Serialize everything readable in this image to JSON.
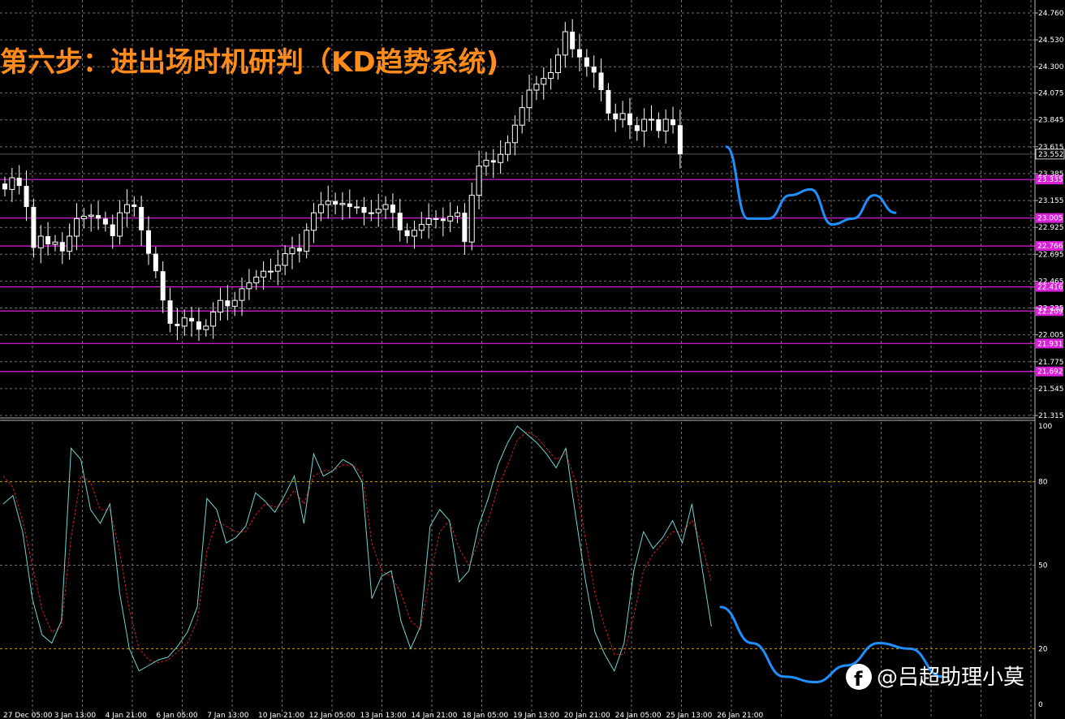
{
  "title": "第六步：进出场时机研判（KD趋势系统)",
  "watermark": "@吕超助理小莫",
  "chart_data": [
    {
      "type": "candlestick",
      "name": "price",
      "ylim": [
        21.315,
        24.76
      ],
      "yticks": [
        "24.760",
        "24.530",
        "24.300",
        "24.075",
        "23.845",
        "23.615",
        "23.385",
        "23.155",
        "22.925",
        "22.695",
        "22.465",
        "22.235",
        "22.005",
        "21.775",
        "21.545",
        "21.315"
      ],
      "current_price": "23.552",
      "levels": [
        {
          "label": "23.335",
          "value": 23.335
        },
        {
          "label": "23.005",
          "value": 23.005
        },
        {
          "label": "22.766",
          "value": 22.766
        },
        {
          "label": "22.416",
          "value": 22.416
        },
        {
          "label": "22.209",
          "value": 22.209
        },
        {
          "label": "21.931",
          "value": 21.931
        },
        {
          "label": "21.692",
          "value": 21.692
        }
      ],
      "closes": [
        23.25,
        23.35,
        23.28,
        23.1,
        22.75,
        22.85,
        22.78,
        22.8,
        22.72,
        22.85,
        23.0,
        23.02,
        23.03,
        23.0,
        22.95,
        22.85,
        23.05,
        23.12,
        23.1,
        22.9,
        22.7,
        22.55,
        22.3,
        22.1,
        22.08,
        22.15,
        22.12,
        22.05,
        22.08,
        22.2,
        22.3,
        22.25,
        22.3,
        22.4,
        22.45,
        22.5,
        22.55,
        22.55,
        22.6,
        22.7,
        22.75,
        22.72,
        22.9,
        23.05,
        23.12,
        23.15,
        23.12,
        23.13,
        23.1,
        23.1,
        23.05,
        23.05,
        23.08,
        23.12,
        23.05,
        22.9,
        22.85,
        22.9,
        22.95,
        23.0,
        23.0,
        22.98,
        23.02,
        23.05,
        22.8,
        23.2,
        23.45,
        23.5,
        23.48,
        23.55,
        23.65,
        23.8,
        23.95,
        24.1,
        24.15,
        24.2,
        24.25,
        24.4,
        24.6,
        24.45,
        24.38,
        24.3,
        24.25,
        24.1,
        23.9,
        23.85,
        23.9,
        23.8,
        23.75,
        23.85,
        23.85,
        23.75,
        23.85,
        23.8,
        23.55
      ],
      "predicted_path": [
        23.615,
        23.0,
        23.0,
        23.2,
        23.25,
        22.95,
        23.0,
        23.2,
        23.05
      ]
    },
    {
      "type": "line",
      "name": "stochastic",
      "ylim": [
        0,
        100
      ],
      "yticks": [
        "100",
        "80",
        "50",
        "20",
        "0"
      ],
      "k_values": [
        72,
        75,
        62,
        38,
        25,
        22,
        30,
        92,
        88,
        70,
        65,
        72,
        40,
        20,
        12,
        14,
        16,
        17,
        21,
        26,
        35,
        74,
        70,
        58,
        60,
        64,
        76,
        73,
        69,
        75,
        82,
        65,
        90,
        82,
        84,
        88,
        86,
        80,
        38,
        46,
        48,
        30,
        20,
        28,
        64,
        70,
        66,
        44,
        48,
        64,
        74,
        86,
        94,
        100,
        97,
        94,
        90,
        85,
        92,
        68,
        45,
        26,
        18,
        12,
        22,
        48,
        62,
        56,
        60,
        66,
        58,
        72,
        50,
        28
      ],
      "d_values": [
        82,
        78,
        66,
        50,
        34,
        26,
        28,
        60,
        82,
        80,
        70,
        70,
        55,
        34,
        20,
        16,
        15,
        16,
        19,
        22,
        30,
        55,
        66,
        64,
        62,
        62,
        68,
        72,
        71,
        72,
        77,
        72,
        82,
        84,
        84,
        86,
        86,
        83,
        58,
        48,
        46,
        40,
        30,
        27,
        46,
        62,
        66,
        56,
        50,
        58,
        66,
        78,
        86,
        95,
        98,
        96,
        92,
        88,
        90,
        80,
        60,
        40,
        28,
        18,
        18,
        32,
        48,
        54,
        58,
        62,
        62,
        66,
        58,
        44
      ],
      "predicted_path": [
        35,
        22,
        10,
        8,
        14,
        22,
        20,
        10
      ]
    }
  ],
  "time_labels": [
    "27 Dec 05:00",
    "3 Jan 13:00",
    "4 Jan 21:00",
    "6 Jan 05:00",
    "7 Jan 13:00",
    "10 Jan 21:00",
    "12 Jan 05:00",
    "13 Jan 13:00",
    "14 Jan 21:00",
    "18 Jan 05:00",
    "19 Jan 13:00",
    "20 Jan 21:00",
    "24 Jan 05:00",
    "25 Jan 13:00",
    "26 Jan 21:00"
  ],
  "colors": {
    "background": "#000000",
    "grid": "#6f6f6f",
    "candle": "#ffffff",
    "level_line": "#e020e0",
    "level_label_bg": "#d820d8",
    "stoch_k": "#6fd6d6",
    "stoch_d": "#cc2020",
    "prediction": "#1e90ff",
    "stoch_level_line": "#c8a000"
  }
}
